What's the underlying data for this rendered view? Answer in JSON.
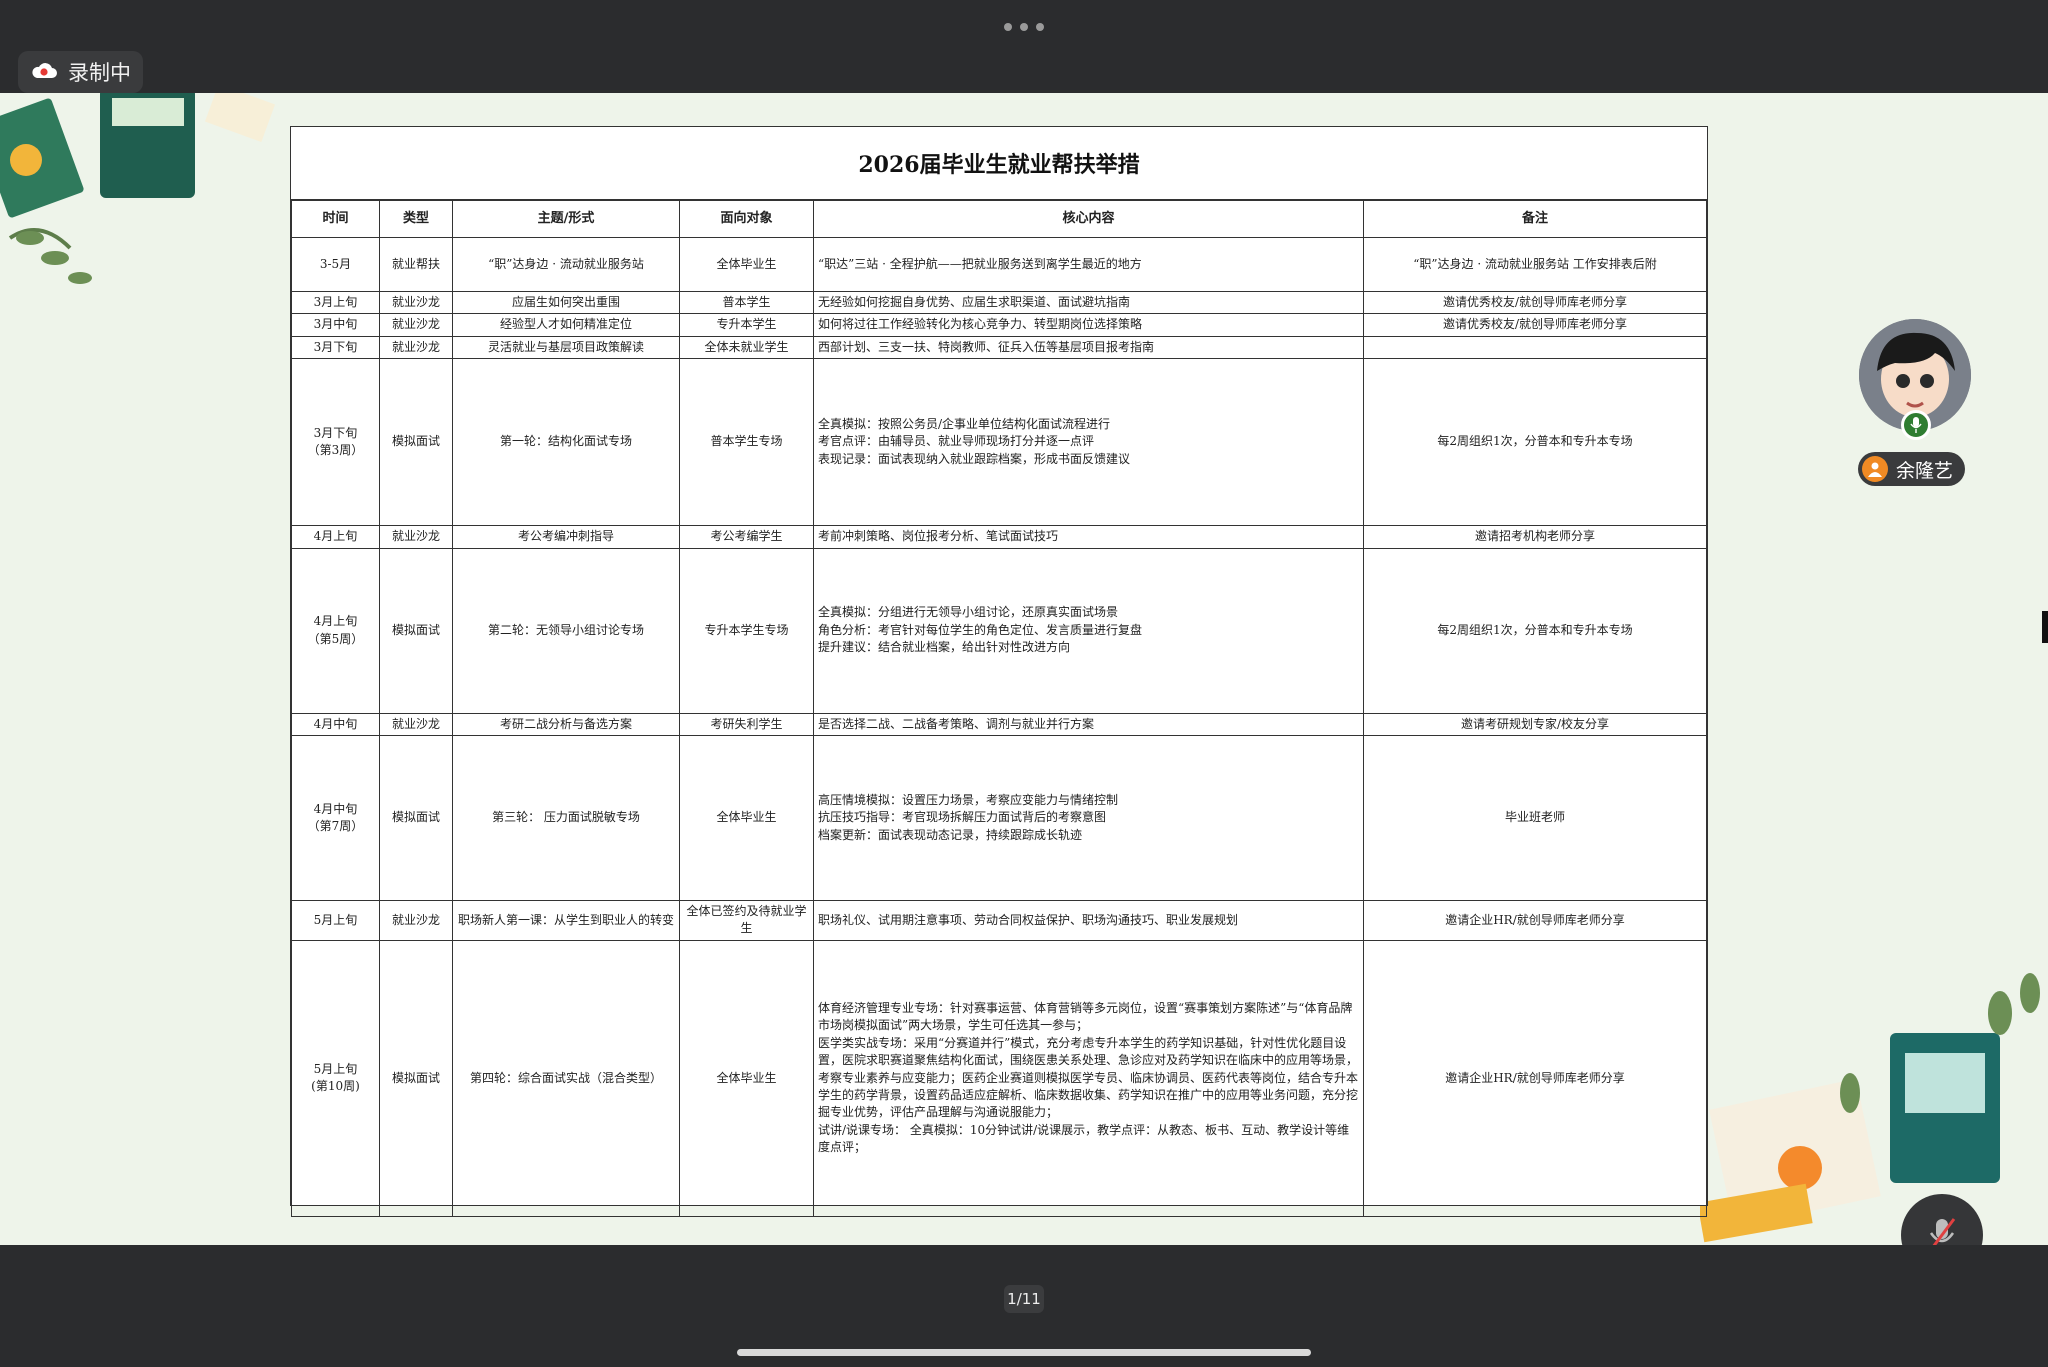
{
  "app": {
    "recording_label": "录制中",
    "participant_name": "余隆艺",
    "page_indicator": "1/11"
  },
  "icons": {
    "recording": "cloud-record-icon",
    "more": "more-dots-icon",
    "participant": "person-icon",
    "mic_active": "mic-icon",
    "mute": "mic-muted-icon"
  },
  "colors": {
    "chrome": "#2b2c2e",
    "stage_bg": "#eef4ea",
    "record_red": "#e53935",
    "name_badge": "#f08a24",
    "mic_green": "#2f7d32"
  },
  "slide": {
    "title": "2026届毕业生就业帮扶举措",
    "headers": [
      "时间",
      "类型",
      "主题/形式",
      "面向对象",
      "核心内容",
      "备注"
    ],
    "rows": [
      {
        "time": "3-5月",
        "type": "就业帮扶",
        "topic": "“职”达身边 · 流动就业服务站",
        "target": "全体毕业生",
        "content": "“职达”三站 · 全程护航——把就业服务送到离学生最近的地方",
        "note": "“职”达身边 · 流动就业服务站 工作安排表后附"
      },
      {
        "time": "3月上旬",
        "type": "就业沙龙",
        "topic": "应届生如何突出重围",
        "target": "普本学生",
        "content": "无经验如何挖掘自身优势、应届生求职渠道、面试避坑指南",
        "note": "邀请优秀校友/就创导师库老师分享"
      },
      {
        "time": "3月中旬",
        "type": "就业沙龙",
        "topic": "经验型人才如何精准定位",
        "target": "专升本学生",
        "content": "如何将过往工作经验转化为核心竞争力、转型期岗位选择策略",
        "note": "邀请优秀校友/就创导师库老师分享"
      },
      {
        "time": "3月下旬",
        "type": "就业沙龙",
        "topic": "灵活就业与基层项目政策解读",
        "target": "全体未就业学生",
        "content": "西部计划、三支一扶、特岗教师、征兵入伍等基层项目报考指南",
        "note": ""
      },
      {
        "time": "3月下旬\n（第3周）",
        "type": "模拟面试",
        "topic": "第一轮：结构化面试专场",
        "target": "普本学生专场",
        "content": "全真模拟：按照公务员/企事业单位结构化面试流程进行\n考官点评：由辅导员、就业导师现场打分并逐一点评\n表现记录：面试表现纳入就业跟踪档案，形成书面反馈建议",
        "note": "每2周组织1次，分普本和专升本专场"
      },
      {
        "time": "4月上旬",
        "type": "就业沙龙",
        "topic": "考公考编冲刺指导",
        "target": "考公考编学生",
        "content": "考前冲刺策略、岗位报考分析、笔试面试技巧",
        "note": "邀请招考机构老师分享"
      },
      {
        "time": "4月上旬\n（第5周）",
        "type": "模拟面试",
        "topic": "第二轮：无领导小组讨论专场",
        "target": "专升本学生专场",
        "content": "全真模拟：分组进行无领导小组讨论，还原真实面试场景\n角色分析：考官针对每位学生的角色定位、发言质量进行复盘\n提升建议：结合就业档案，给出针对性改进方向",
        "note": "每2周组织1次，分普本和专升本专场"
      },
      {
        "time": "4月中旬",
        "type": "就业沙龙",
        "topic": "考研二战分析与备选方案",
        "target": "考研失利学生",
        "content": "是否选择二战、二战备考策略、调剂与就业并行方案",
        "note": "邀请考研规划专家/校友分享"
      },
      {
        "time": "4月中旬\n（第7周）",
        "type": "模拟面试",
        "topic": "第三轮： 压力面试脱敏专场",
        "target": "全体毕业生",
        "content": "高压情境模拟：设置压力场景，考察应变能力与情绪控制\n抗压技巧指导：考官现场拆解压力面试背后的考察意图\n档案更新：面试表现动态记录，持续跟踪成长轨迹",
        "note": "毕业班老师"
      },
      {
        "time": "5月上旬",
        "type": "就业沙龙",
        "topic": "职场新人第一课：从学生到职业人的转变",
        "target": "全体已签约及待就业学生",
        "content": "职场礼仪、试用期注意事项、劳动合同权益保护、职场沟通技巧、职业发展规划",
        "note": "邀请企业HR/就创导师库老师分享"
      },
      {
        "time": "5月上旬\n(第10周)",
        "type": "模拟面试",
        "topic": "第四轮：综合面试实战（混合类型）",
        "target": "全体毕业生",
        "content": "体育经济管理专业专场：针对赛事运营、体育营销等多元岗位，设置“赛事策划方案陈述”与“体育品牌市场岗模拟面试”两大场景，学生可任选其一参与；\n医学类实战专场：采用“分赛道并行”模式，充分考虑专升本学生的药学知识基础，针对性优化题目设置，医院求职赛道聚焦结构化面试，围绕医患关系处理、急诊应对及药学知识在临床中的应用等场景，考察专业素养与应变能力；医药企业赛道则模拟医学专员、临床协调员、医药代表等岗位，结合专升本学生的药学背景，设置药品适应症解析、临床数据收集、药学知识在推广中的应用等业务问题，充分挖掘专业优势，评估产品理解与沟通说服能力；\n试讲/说课专场： 全真模拟：10分钟试讲/说课展示，教学点评：从教态、板书、互动、教学设计等维度点评；",
        "note": "邀请企业HR/就创导师库老师分享"
      }
    ]
  }
}
